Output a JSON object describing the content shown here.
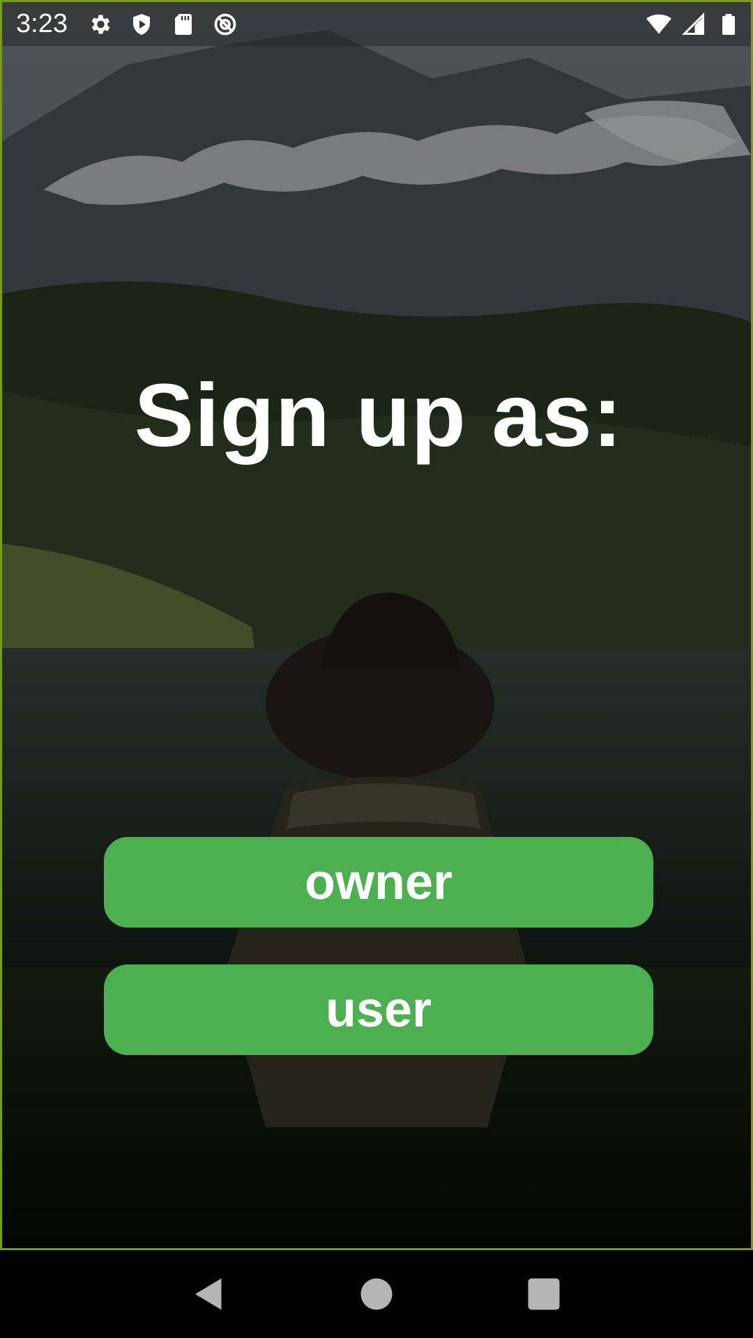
{
  "status_bar": {
    "time": "3:23",
    "left_icons": [
      "settings-icon",
      "shield-play-icon",
      "sd-card-icon",
      "no-disturb-icon"
    ],
    "right_icons": [
      "wifi-icon",
      "cellular-signal-icon",
      "battery-icon"
    ]
  },
  "main": {
    "title": "Sign up as:",
    "buttons": [
      {
        "label": "owner"
      },
      {
        "label": "user"
      }
    ],
    "accent_color": "#4caf50",
    "background": "mountain-lake-photo"
  },
  "nav_bar": {
    "buttons": [
      "back-icon",
      "home-icon",
      "recents-icon"
    ]
  }
}
